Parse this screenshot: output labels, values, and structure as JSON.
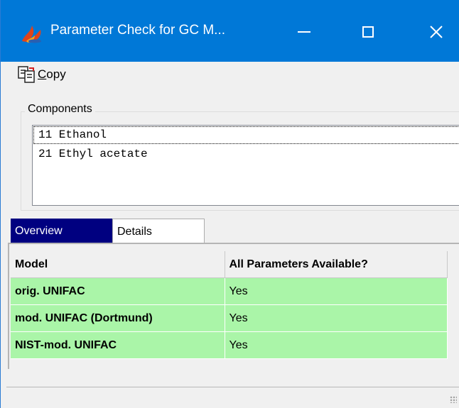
{
  "window": {
    "title": "Parameter Check for GC M...",
    "app_icon": "flame-icon",
    "controls": [
      "minimize-icon",
      "maximize-icon",
      "close-icon"
    ]
  },
  "toolbar": {
    "copy_hotkey": "C",
    "copy_rest": "opy",
    "copy_icon": "copy-icon"
  },
  "components": {
    "group_label": "Components",
    "items": [
      "11 Ethanol",
      "21 Ethyl acetate"
    ]
  },
  "tabs": [
    {
      "label": "Overview",
      "active": true
    },
    {
      "label": "Details",
      "active": false
    }
  ],
  "table": {
    "headers": [
      "Model",
      "All Parameters Available?"
    ],
    "rows": [
      {
        "model": "orig. UNIFAC",
        "available": "Yes"
      },
      {
        "model": "mod. UNIFAC (Dortmund)",
        "available": "Yes"
      },
      {
        "model": "NIST-mod. UNIFAC",
        "available": "Yes"
      }
    ],
    "row_color": "#aaf5a8"
  },
  "colors": {
    "titlebar": "#0078d7",
    "active_tab": "#000080",
    "window_bg": "#f0f0f0"
  }
}
